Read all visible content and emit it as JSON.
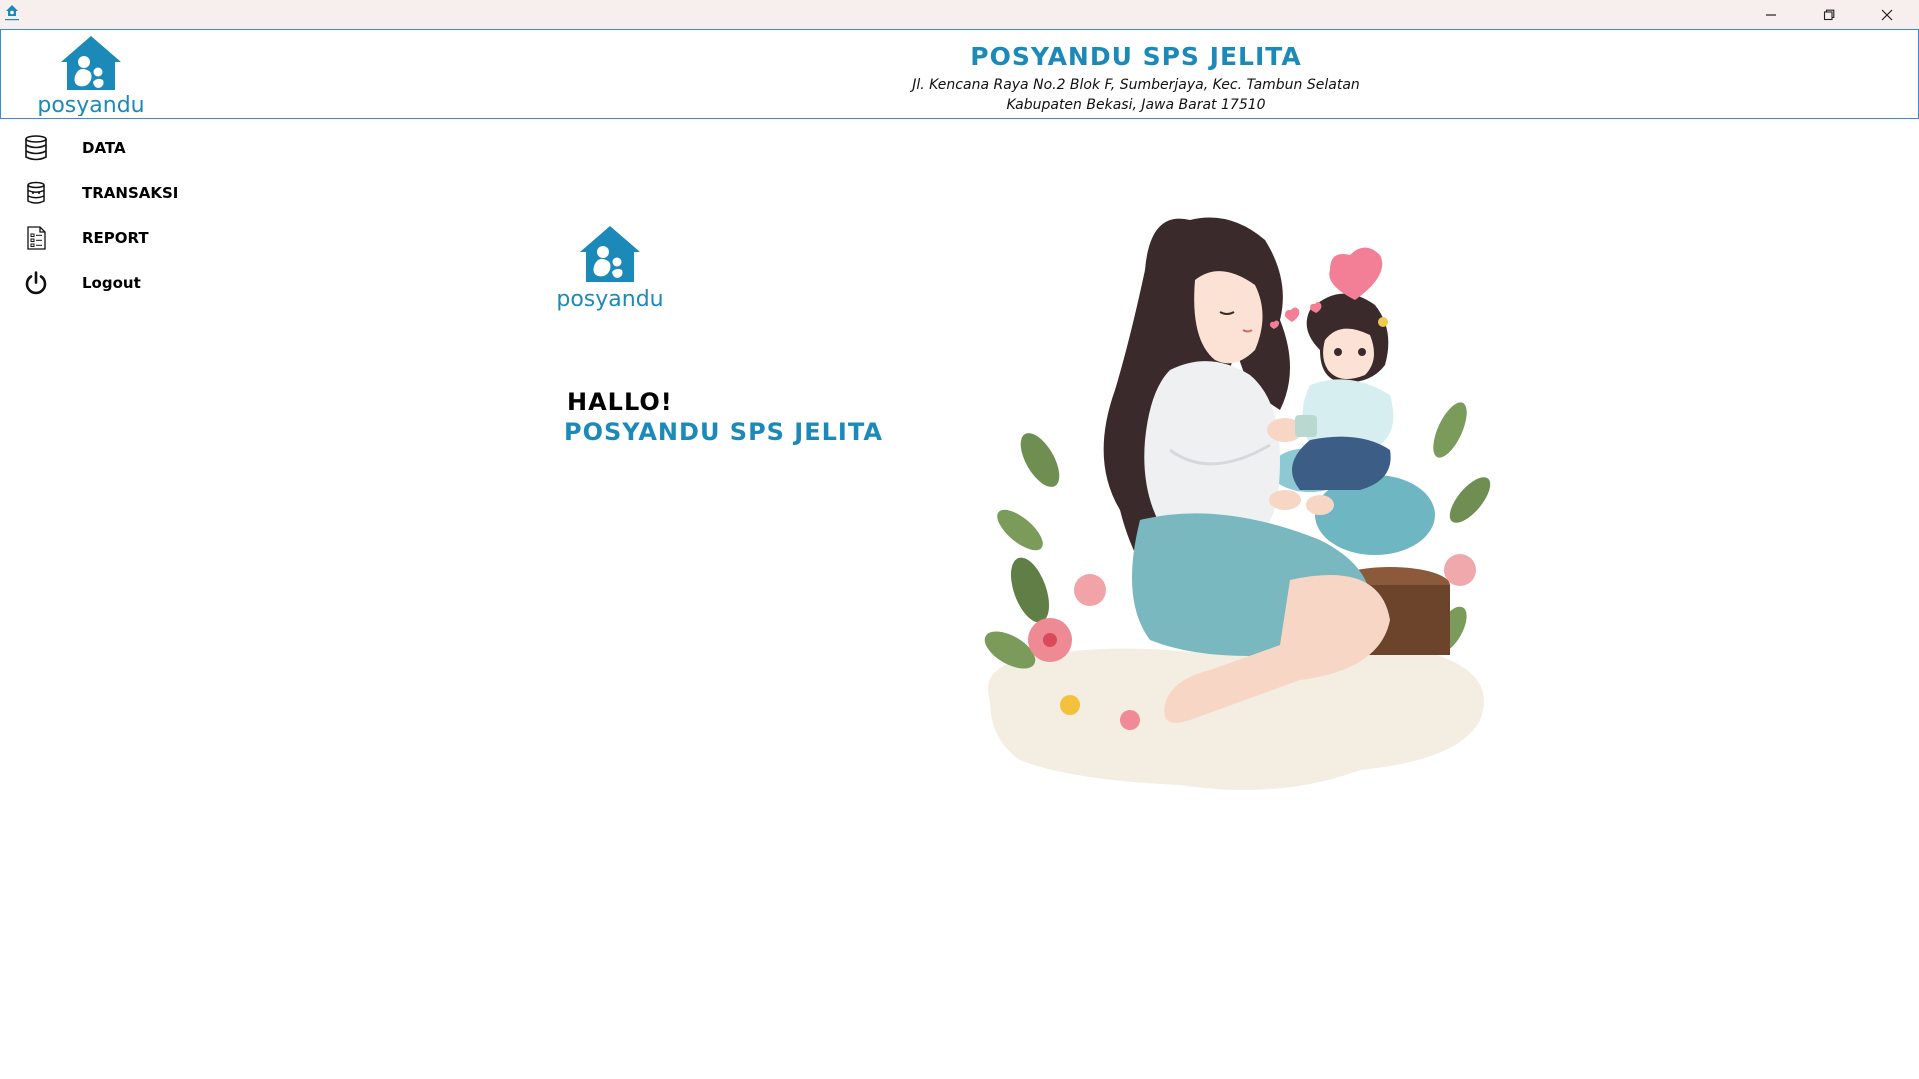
{
  "window": {
    "minimize_label": "minimize",
    "restore_label": "restore",
    "close_label": "close"
  },
  "brand": {
    "logo_text": "posyandu",
    "accent_color": "#1b8ab8"
  },
  "header": {
    "title": "POSYANDU SPS JELITA",
    "address_line1": "Jl. Kencana Raya No.2 Blok F, Sumberjaya, Kec. Tambun Selatan",
    "address_line2": "Kabupaten Bekasi, Jawa Barat 17510"
  },
  "sidebar": {
    "items": [
      {
        "label": "DATA",
        "icon": "database-icon"
      },
      {
        "label": "TRANSAKSI",
        "icon": "transaction-database-icon"
      },
      {
        "label": "REPORT",
        "icon": "report-icon"
      },
      {
        "label": "Logout",
        "icon": "power-icon"
      }
    ]
  },
  "main": {
    "logo_text": "posyandu",
    "greeting": "HALLO!",
    "greeting_name": "POSYANDU SPS JELITA"
  }
}
